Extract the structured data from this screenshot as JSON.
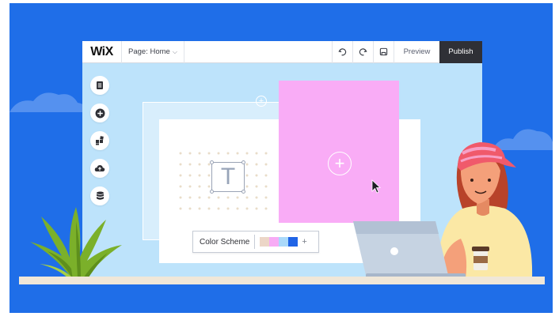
{
  "app": {
    "logo": "WiX",
    "page_selector": "Page: Home",
    "preview_label": "Preview",
    "publish_label": "Publish"
  },
  "canvas": {
    "text_placeholder": "T",
    "color_scheme_label": "Color Scheme",
    "color_scheme_add": "+",
    "swatches": [
      "#ecd6c7",
      "#f7abf5",
      "#aad9fa",
      "#2064e6"
    ]
  },
  "colors": {
    "background": "#1f6ee8",
    "editor_canvas": "#bde3fb",
    "pink_strip": "#f9acf6",
    "publish_button": "#2f3036",
    "plant": "#7bb02a",
    "cap": "#f05a6b",
    "shirt": "#fbe8a5",
    "laptop": "#c6d3e2"
  }
}
